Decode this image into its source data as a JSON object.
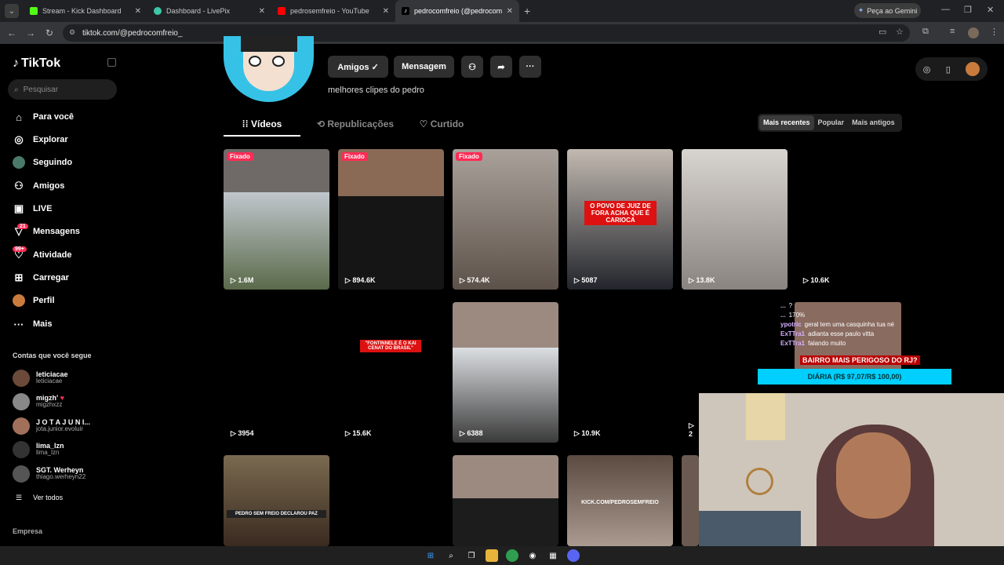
{
  "browser": {
    "tabs": [
      {
        "title": "Stream - Kick Dashboard",
        "color": "#53fc18"
      },
      {
        "title": "Dashboard - LivePix",
        "color": "#3ec6a8"
      },
      {
        "title": "pedrosemfreio - YouTube",
        "color": "#ff0000"
      },
      {
        "title": "pedrocomfreio (@pedrocomfreio",
        "color": "#ffffff"
      }
    ],
    "gemini_label": "Peça ao Gemini",
    "url": "tiktok.com/@pedrocomfreio_"
  },
  "sidebar": {
    "logo": "TikTok",
    "search_placeholder": "Pesquisar",
    "items": [
      {
        "label": "Para você",
        "icon": "home-icon"
      },
      {
        "label": "Explorar",
        "icon": "compass-icon"
      },
      {
        "label": "Seguindo",
        "icon": "following-icon"
      },
      {
        "label": "Amigos",
        "icon": "friends-icon"
      },
      {
        "label": "LIVE",
        "icon": "live-icon"
      },
      {
        "label": "Mensagens",
        "icon": "messages-icon",
        "badge": "21"
      },
      {
        "label": "Atividade",
        "icon": "activity-icon",
        "badge": "99+"
      },
      {
        "label": "Carregar",
        "icon": "upload-icon"
      },
      {
        "label": "Perfil",
        "icon": "profile-icon"
      },
      {
        "label": "Mais",
        "icon": "more-icon"
      }
    ],
    "following_title": "Contas que você segue",
    "accounts": [
      {
        "name": "leticiacae",
        "user": "leticiacae"
      },
      {
        "name": "migzh'",
        "user": "migzhxzz"
      },
      {
        "name": "J O T A J U N I...",
        "user": "jota.junior.evoluir"
      },
      {
        "name": "lima_lzn",
        "user": "lima_lzn"
      },
      {
        "name": "SGT. Werheyn",
        "user": "thiago.werheyn22"
      }
    ],
    "see_all": "Ver todos",
    "footer": "Empresa"
  },
  "profile": {
    "friends_button": "Amigos ✓",
    "message_button": "Mensagem",
    "bio": "melhores clipes do pedro",
    "tabs": [
      "Vídeos",
      "Republicações",
      "Curtido"
    ],
    "sort": [
      "Mais recentes",
      "Popular",
      "Mais antigos"
    ]
  },
  "videos": [
    {
      "views": "1.6M",
      "pinned": "Fixado"
    },
    {
      "views": "894.6K",
      "pinned": "Fixado"
    },
    {
      "views": "574.4K",
      "pinned": "Fixado"
    },
    {
      "views": "5087",
      "caption": "O POVO DE JUIZ DE FORA ACHA QUE É CARIOCA"
    },
    {
      "views": "13.8K"
    },
    {
      "views": "10.6K"
    },
    {
      "views": "3954"
    },
    {
      "views": "15.6K",
      "caption": "\"FONTINNELE É O KAI CENAT DO BRASIL\""
    },
    {
      "views": "6388"
    },
    {
      "views": "10.9K"
    },
    {
      "views": "2"
    },
    {
      "caption": "PEDRO SEM FREIO DECLAROU PAZ"
    },
    {},
    {},
    {
      "caption": "KICK.COM/PEDROSEMFREIO"
    }
  ],
  "overlay": {
    "chat": [
      {
        "user": "...",
        "msg": "?"
      },
      {
        "user": "...",
        "msg": "170%"
      },
      {
        "user": "ypotric",
        "msg": "geral tem uma casquinha tua né"
      },
      {
        "user": "ExTTra1",
        "msg": "adianta esse paulo vitta"
      },
      {
        "user": "ExTTra1",
        "msg": "falando muito"
      }
    ],
    "headline": "BAIRRO MAIS PERIGOSO DO RJ?",
    "goal": "DIÁRIA (R$ 97,07/R$ 100,00)"
  }
}
